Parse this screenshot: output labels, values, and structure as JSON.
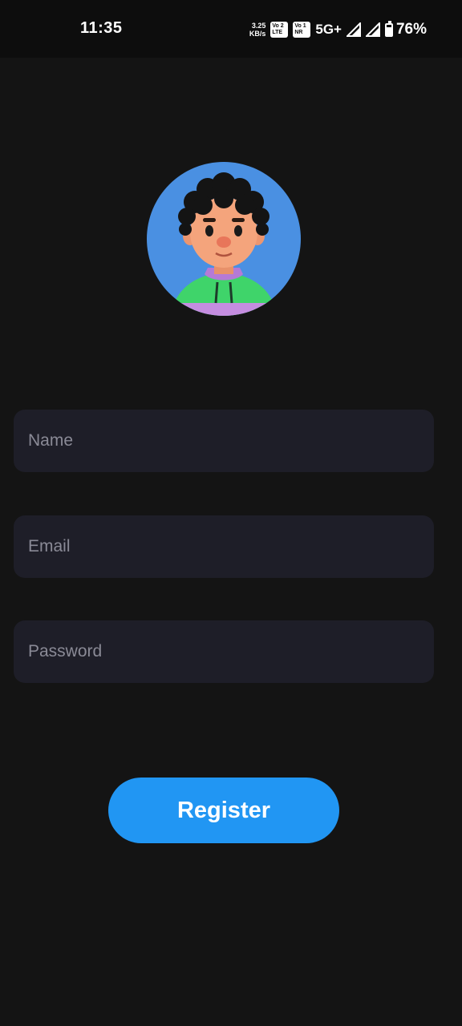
{
  "status_bar": {
    "time": "11:35",
    "speed_value": "3.25",
    "speed_unit": "KB/s",
    "sim1_badge_top": "Vo",
    "sim1_badge_bottom": "LTE",
    "sim1_badge_num": "2",
    "sim2_badge_top": "Vo",
    "sim2_badge_bottom": "NR",
    "sim2_badge_num": "1",
    "network": "5G+",
    "battery_percent": "76%",
    "battery_level": 0.76
  },
  "avatar": {
    "icon": "avatar-3d-boy",
    "background_color": "#4a90e2"
  },
  "form": {
    "name_placeholder": "Name",
    "email_placeholder": "Email",
    "password_placeholder": "Password",
    "register_label": "Register"
  },
  "colors": {
    "background": "#141414",
    "field_background": "#1e1e28",
    "accent": "#2196f3"
  }
}
